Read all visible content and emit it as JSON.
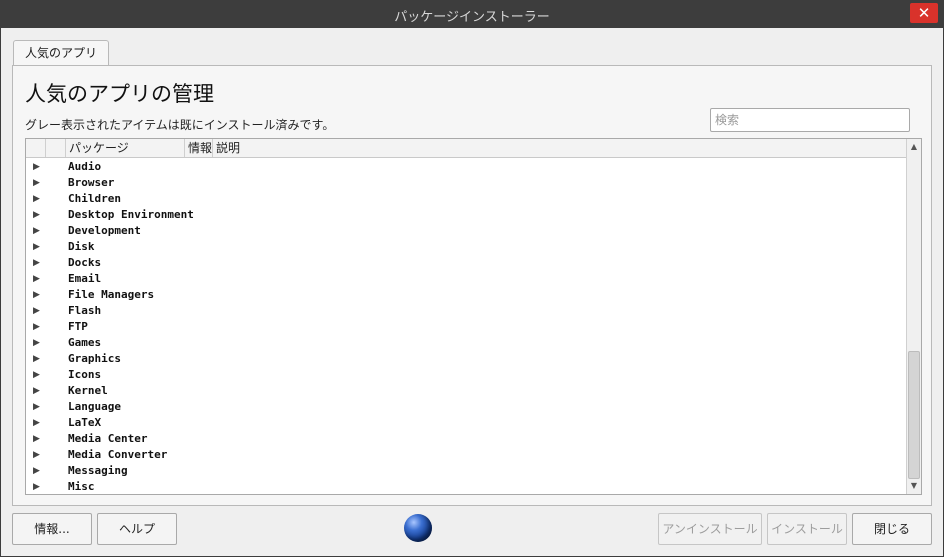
{
  "window": {
    "title": "パッケージインストーラー",
    "close_glyph": "✕"
  },
  "tab": {
    "label": "人気のアプリ"
  },
  "heading": "人気のアプリの管理",
  "subtext": "グレー表示されたアイテムは既にインストール済みです。",
  "search": {
    "placeholder": "検索",
    "value": ""
  },
  "tree": {
    "columns": [
      "パッケージ",
      "情報",
      "説明"
    ],
    "items": [
      "Audio",
      "Browser",
      "Children",
      "Desktop Environment",
      "Development",
      "Disk",
      "Docks",
      "Email",
      "File Managers",
      "Flash",
      "FTP",
      "Games",
      "Graphics",
      "Icons",
      "Kernel",
      "Language",
      "LaTeX",
      "Media Center",
      "Media Converter",
      "Messaging",
      "Misc"
    ]
  },
  "buttons": {
    "info": "情報...",
    "help": "ヘルプ",
    "uninstall": "アンインストール",
    "install": "インストール",
    "close": "閉じる"
  },
  "icons": {
    "expand": "expand-arrow-icon",
    "globe": "globe-icon",
    "close": "close-icon"
  }
}
